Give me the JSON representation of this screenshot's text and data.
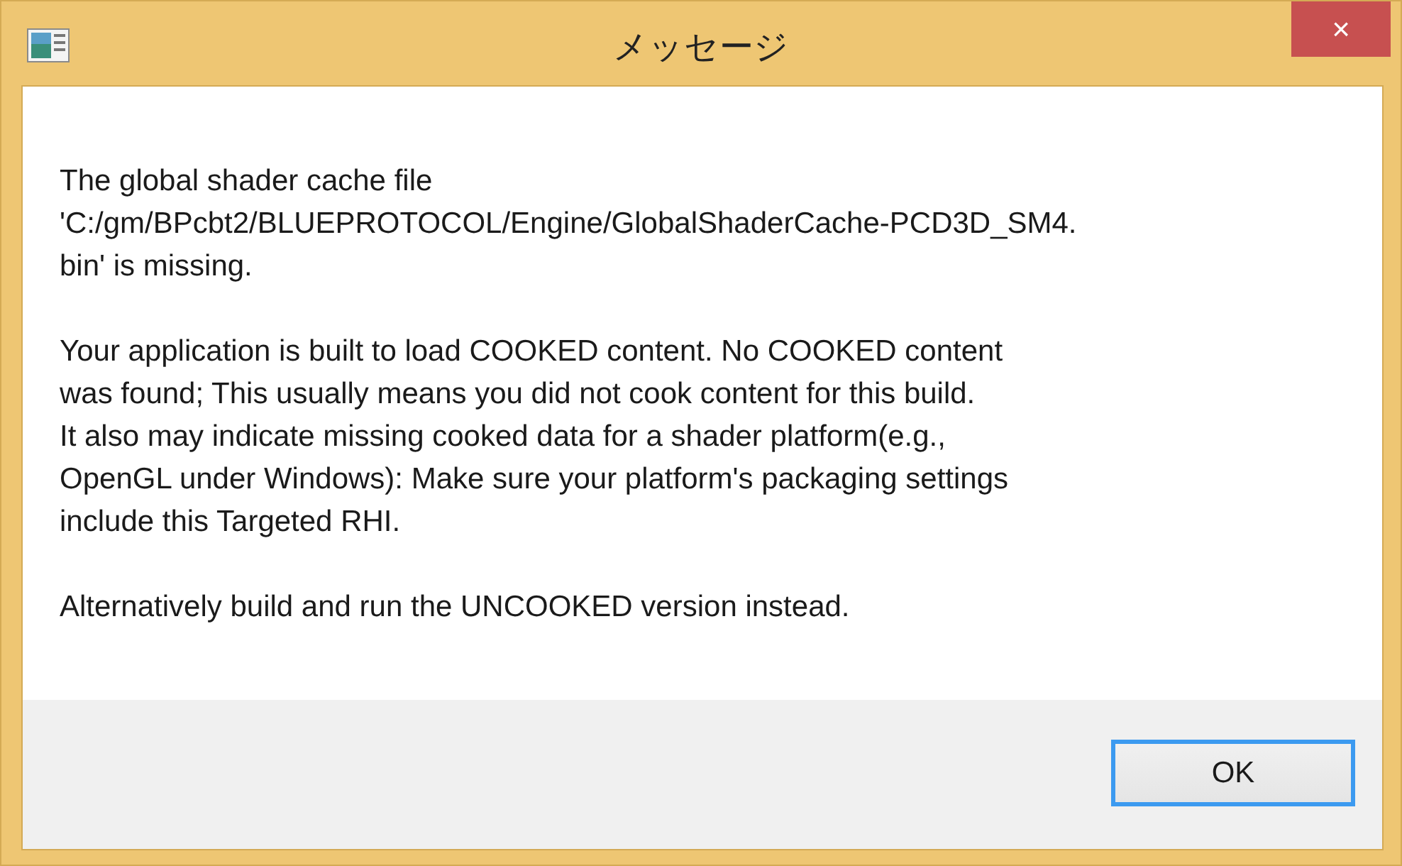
{
  "window": {
    "title": "メッセージ",
    "close": "×"
  },
  "message": {
    "paragraphs": [
      "The global shader cache file\n'C:/gm/BPcbt2/BLUEPROTOCOL/Engine/GlobalShaderCache-PCD3D_SM4.\nbin' is missing.",
      "Your application is built to load COOKED content. No COOKED content\nwas found; This usually means you did not cook content for this build.\nIt also may indicate missing cooked data for a shader platform(e.g.,\nOpenGL under Windows): Make sure your platform's packaging settings\ninclude this Targeted RHI.",
      "Alternatively build and run the UNCOOKED version instead."
    ]
  },
  "buttons": [
    {
      "label": "OK",
      "focused": true
    }
  ]
}
